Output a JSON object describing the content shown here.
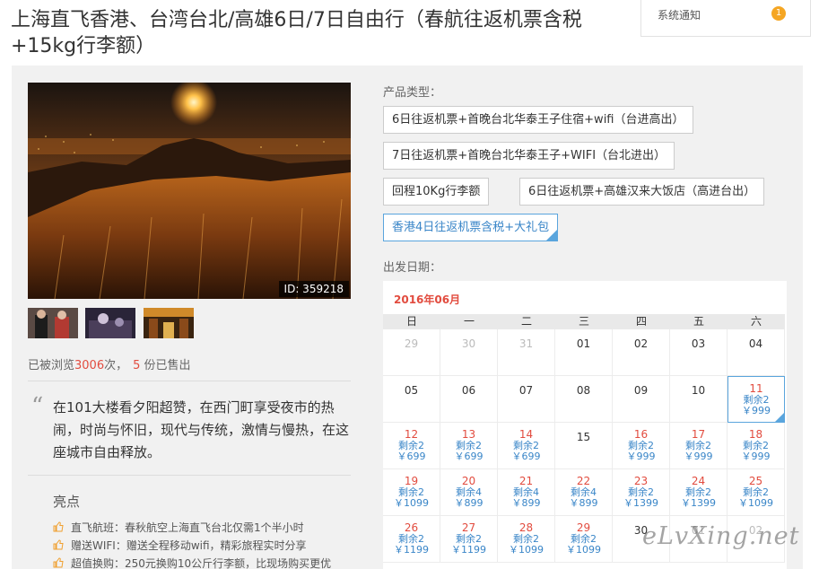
{
  "page": {
    "title": "上海直飞香港、台湾台北/高雄6日/7日自由行（春航往返机票含税+15kg行李额）"
  },
  "notice": {
    "label": "系统通知",
    "count": "1"
  },
  "gallery": {
    "image_id": "ID: 359218",
    "thumbnails": [
      "thumb-ceremony-icon",
      "thumb-night-market-icon",
      "thumb-street-icon"
    ]
  },
  "stats": {
    "prefix": "已被浏览",
    "views": "3006",
    "mid": "次，",
    "sold": "5",
    "suffix": "份已售出"
  },
  "intro": "在101大楼看夕阳超赞，在西门町享受夜市的热闹，时尚与怀旧，现代与传统，激情与慢热，在这座城市自由释放。",
  "highlights": {
    "title": "亮点",
    "items": [
      "直飞航班：春秋航空上海直飞台北仅需1个半小时",
      "赠送WIFI：赠送全程移动wifi，精彩旅程实时分享",
      "超值换购：250元换购10公斤行李额，比现场购买更优"
    ]
  },
  "product_type": {
    "label": "产品类型：",
    "options": [
      "6日往返机票+首晚台北华泰王子住宿+wifi（台进高出）",
      "7日往返机票+首晚台北华泰王子+WIFI（台北进出）",
      "回程10Kg行李额",
      "6日往返机票+高雄汉来大饭店（高进台出）",
      "香港4日往返机票含税+大礼包"
    ],
    "selected_index": 4
  },
  "departure": {
    "label": "出发日期：",
    "month": "2016年06月",
    "weekdays": [
      "日",
      "一",
      "二",
      "三",
      "四",
      "五",
      "六"
    ],
    "rows": [
      [
        {
          "d": "29",
          "o": true
        },
        {
          "d": "30",
          "o": true
        },
        {
          "d": "31",
          "o": true
        },
        {
          "d": "01"
        },
        {
          "d": "02"
        },
        {
          "d": "03"
        },
        {
          "d": "04"
        }
      ],
      [
        {
          "d": "05"
        },
        {
          "d": "06"
        },
        {
          "d": "07"
        },
        {
          "d": "08"
        },
        {
          "d": "09"
        },
        {
          "d": "10"
        },
        {
          "d": "11",
          "r": "剩余2",
          "p": "￥999",
          "sel": true
        }
      ],
      [
        {
          "d": "12",
          "r": "剩余2",
          "p": "￥699"
        },
        {
          "d": "13",
          "r": "剩余2",
          "p": "￥699"
        },
        {
          "d": "14",
          "r": "剩余2",
          "p": "￥699"
        },
        {
          "d": "15"
        },
        {
          "d": "16",
          "r": "剩余2",
          "p": "￥999"
        },
        {
          "d": "17",
          "r": "剩余2",
          "p": "￥999"
        },
        {
          "d": "18",
          "r": "剩余2",
          "p": "￥999"
        }
      ],
      [
        {
          "d": "19",
          "r": "剩余2",
          "p": "￥1099"
        },
        {
          "d": "20",
          "r": "剩余4",
          "p": "￥899"
        },
        {
          "d": "21",
          "r": "剩余4",
          "p": "￥899"
        },
        {
          "d": "22",
          "r": "剩余4",
          "p": "￥899"
        },
        {
          "d": "23",
          "r": "剩余2",
          "p": "￥1399"
        },
        {
          "d": "24",
          "r": "剩余2",
          "p": "￥1399"
        },
        {
          "d": "25",
          "r": "剩余2",
          "p": "￥1099"
        }
      ],
      [
        {
          "d": "26",
          "r": "剩余2",
          "p": "￥1199"
        },
        {
          "d": "27",
          "r": "剩余2",
          "p": "￥1199"
        },
        {
          "d": "28",
          "r": "剩余2",
          "p": "￥1099"
        },
        {
          "d": "29",
          "r": "剩余2",
          "p": "￥1099"
        },
        {
          "d": "30"
        },
        {
          "d": "01",
          "o": true
        },
        {
          "d": "02",
          "o": true
        }
      ]
    ]
  },
  "watermark": "eLvXing.net",
  "colors": {
    "accent_red": "#e24c3f",
    "accent_blue": "#3a86c8",
    "badge": "#f5a623"
  }
}
